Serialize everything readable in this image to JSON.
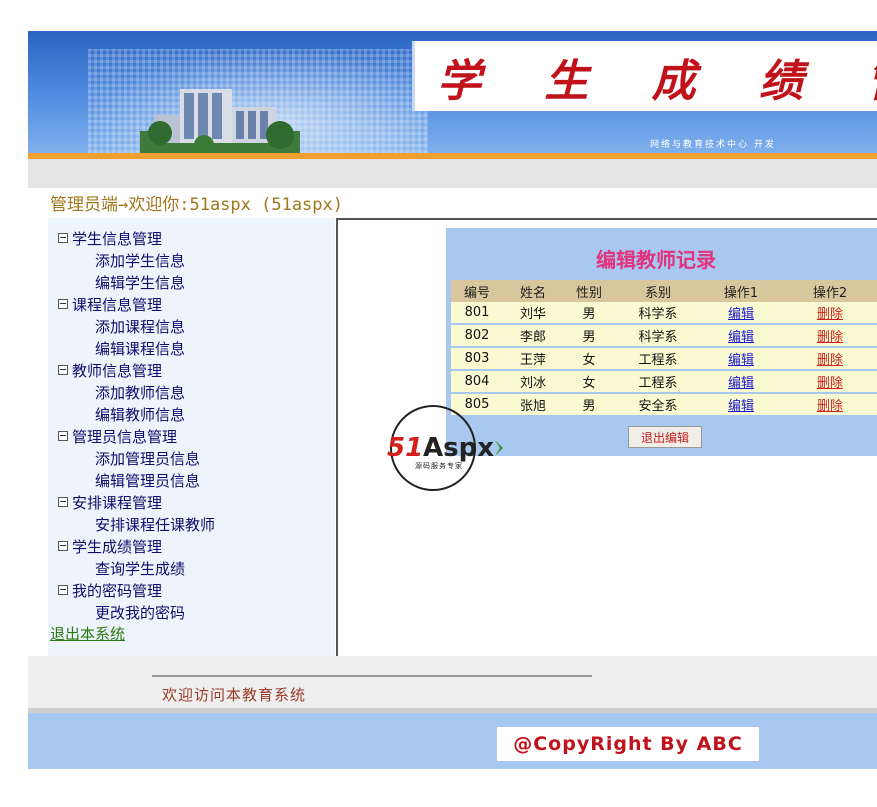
{
  "banner": {
    "title": "学 生 成 绩 管 理 系",
    "subtitle": "网络与教育技术中心 开发"
  },
  "admin_line": "管理员端→欢迎你:51aspx (51aspx)",
  "sidebar": {
    "items": [
      {
        "label": "学生信息管理",
        "level": "top"
      },
      {
        "label": "添加学生信息",
        "level": "sub"
      },
      {
        "label": "编辑学生信息",
        "level": "sub"
      },
      {
        "label": "课程信息管理",
        "level": "top"
      },
      {
        "label": "添加课程信息",
        "level": "sub"
      },
      {
        "label": "编辑课程信息",
        "level": "sub"
      },
      {
        "label": "教师信息管理",
        "level": "top"
      },
      {
        "label": "添加教师信息",
        "level": "sub"
      },
      {
        "label": "编辑教师信息",
        "level": "sub"
      },
      {
        "label": "管理员信息管理",
        "level": "top"
      },
      {
        "label": "添加管理员信息",
        "level": "sub"
      },
      {
        "label": "编辑管理员信息",
        "level": "sub"
      },
      {
        "label": "安排课程管理",
        "level": "top"
      },
      {
        "label": "安排课程任课教师",
        "level": "sub"
      },
      {
        "label": "学生成绩管理",
        "level": "top"
      },
      {
        "label": "查询学生成绩",
        "level": "sub"
      },
      {
        "label": "我的密码管理",
        "level": "top"
      },
      {
        "label": "更改我的密码",
        "level": "sub"
      }
    ],
    "logout": "退出本系统"
  },
  "panel": {
    "title": "编辑教师记录",
    "columns": [
      "编号",
      "姓名",
      "性别",
      "系别",
      "操作1",
      "操作2"
    ],
    "rows": [
      {
        "id": "801",
        "name": "刘华",
        "gender": "男",
        "dept": "科学系",
        "op1": "编辑",
        "op2": "删除"
      },
      {
        "id": "802",
        "name": "李郎",
        "gender": "男",
        "dept": "科学系",
        "op1": "编辑",
        "op2": "删除"
      },
      {
        "id": "803",
        "name": "王萍",
        "gender": "女",
        "dept": "工程系",
        "op1": "编辑",
        "op2": "删除"
      },
      {
        "id": "804",
        "name": "刘冰",
        "gender": "女",
        "dept": "工程系",
        "op1": "编辑",
        "op2": "删除"
      },
      {
        "id": "805",
        "name": "张旭",
        "gender": "男",
        "dept": "安全系",
        "op1": "编辑",
        "op2": "删除"
      }
    ],
    "exit_button": "退出编辑"
  },
  "watermark": {
    "brand": "51Aspx",
    "tagline": "源码服务专家"
  },
  "footer": {
    "welcome": "欢迎访问本教育系统",
    "copyright": "@CopyRight By ABC"
  },
  "colors": {
    "banner_blue": "#2a64c2",
    "title_red": "#c1121b",
    "accent_orange": "#f0a030",
    "panel_blue": "#a8c8f0",
    "panel_title_pink": "#e2337c"
  }
}
